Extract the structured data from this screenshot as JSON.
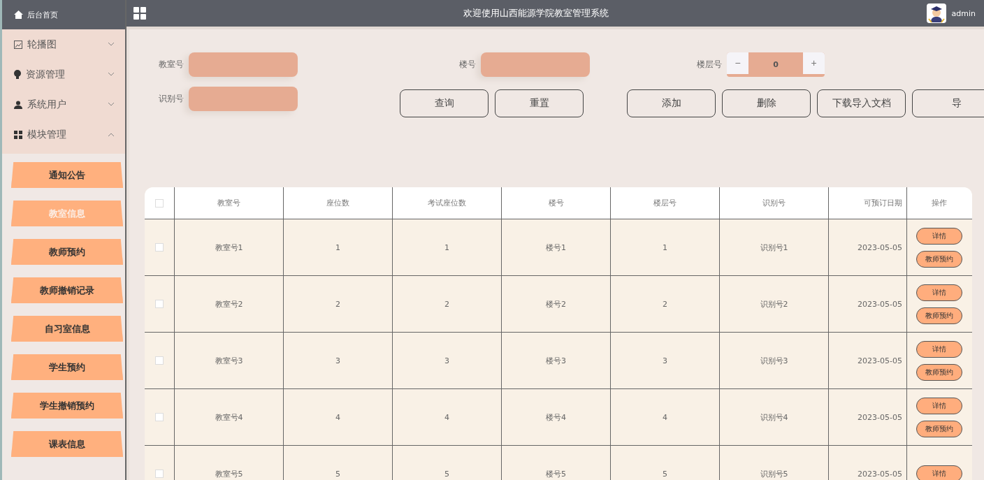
{
  "header": {
    "home_label": "后台首页",
    "title": "欢迎使用山西能源学院教室管理系统",
    "username": "admin"
  },
  "sidebar": {
    "menus": [
      {
        "label": "轮播图",
        "expanded": false
      },
      {
        "label": "资源管理",
        "expanded": false
      },
      {
        "label": "系统用户",
        "expanded": false
      },
      {
        "label": "模块管理",
        "expanded": true
      }
    ],
    "items": [
      {
        "label": "通知公告",
        "selected": false
      },
      {
        "label": "教室信息",
        "selected": true
      },
      {
        "label": "教师预约",
        "selected": false
      },
      {
        "label": "教师撤销记录",
        "selected": false
      },
      {
        "label": "自习室信息",
        "selected": false
      },
      {
        "label": "学生预约",
        "selected": false
      },
      {
        "label": "学生撤销预约",
        "selected": false
      },
      {
        "label": "课表信息",
        "selected": false
      }
    ]
  },
  "search": {
    "fields": [
      {
        "label": "教室号",
        "kind": "text"
      },
      {
        "label": "楼号",
        "kind": "text"
      },
      {
        "label": "楼层号",
        "kind": "stepper",
        "value": "0",
        "minus": "−",
        "plus": "+"
      },
      {
        "label": "识别号",
        "kind": "text"
      }
    ],
    "query_buttons": [
      "查询",
      "重置"
    ],
    "action_buttons": [
      "添加",
      "删除",
      "下载导入文档",
      "导"
    ]
  },
  "table": {
    "all_checked": false,
    "columns": [
      "教室号",
      "座位数",
      "考试座位数",
      "楼号",
      "楼层号",
      "识别号",
      "可预订日期",
      "操作"
    ],
    "rows": [
      {
        "checked": false,
        "cells": [
          "教室号1",
          "1",
          "1",
          "楼号1",
          "1",
          "识别号1",
          "2023-05-05"
        ],
        "actions": [
          "详情",
          "教师预约"
        ]
      },
      {
        "checked": false,
        "cells": [
          "教室号2",
          "2",
          "2",
          "楼号2",
          "2",
          "识别号2",
          "2023-05-05"
        ],
        "actions": [
          "详情",
          "教师预约"
        ]
      },
      {
        "checked": false,
        "cells": [
          "教室号3",
          "3",
          "3",
          "楼号3",
          "3",
          "识别号3",
          "2023-05-05"
        ],
        "actions": [
          "详情",
          "教师预约"
        ]
      },
      {
        "checked": false,
        "cells": [
          "教室号4",
          "4",
          "4",
          "楼号4",
          "4",
          "识别号4",
          "2023-05-05"
        ],
        "actions": [
          "详情",
          "教师预约"
        ]
      },
      {
        "checked": false,
        "cells": [
          "教室号5",
          "5",
          "5",
          "楼号5",
          "5",
          "识别号5",
          "2023-05-05"
        ],
        "actions": [
          "详情"
        ]
      }
    ]
  }
}
